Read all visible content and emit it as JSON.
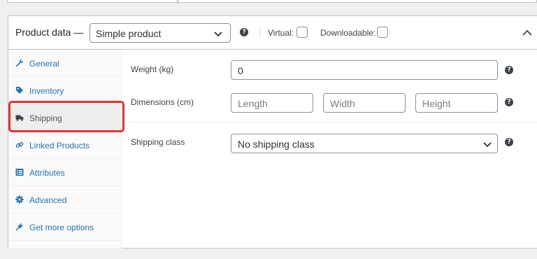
{
  "product_data": {
    "title": "Product data —",
    "type_select": {
      "value": "Simple product"
    },
    "virtual_label": "Virtual:",
    "downloadable_label": "Downloadable:",
    "help_glyph": "?"
  },
  "tabs": [
    {
      "label": "General",
      "icon": "wrench-icon",
      "active": false
    },
    {
      "label": "Inventory",
      "icon": "tag-icon",
      "active": false
    },
    {
      "label": "Shipping",
      "icon": "truck-icon",
      "active": true
    },
    {
      "label": "Linked Products",
      "icon": "link-icon",
      "active": false
    },
    {
      "label": "Attributes",
      "icon": "list-icon",
      "active": false
    },
    {
      "label": "Advanced",
      "icon": "gear-icon",
      "active": false
    },
    {
      "label": "Get more options",
      "icon": "plugin-icon",
      "active": false
    }
  ],
  "shipping": {
    "weight": {
      "label": "Weight (kg)",
      "value": "0"
    },
    "dimensions": {
      "label": "Dimensions (cm)",
      "length_placeholder": "Length",
      "width_placeholder": "Width",
      "height_placeholder": "Height"
    },
    "shipping_class": {
      "label": "Shipping class",
      "value": "No shipping class"
    }
  },
  "colors": {
    "link_blue": "#2271b1",
    "highlight_red": "#e03333",
    "border_gray": "#c3c4c7"
  }
}
